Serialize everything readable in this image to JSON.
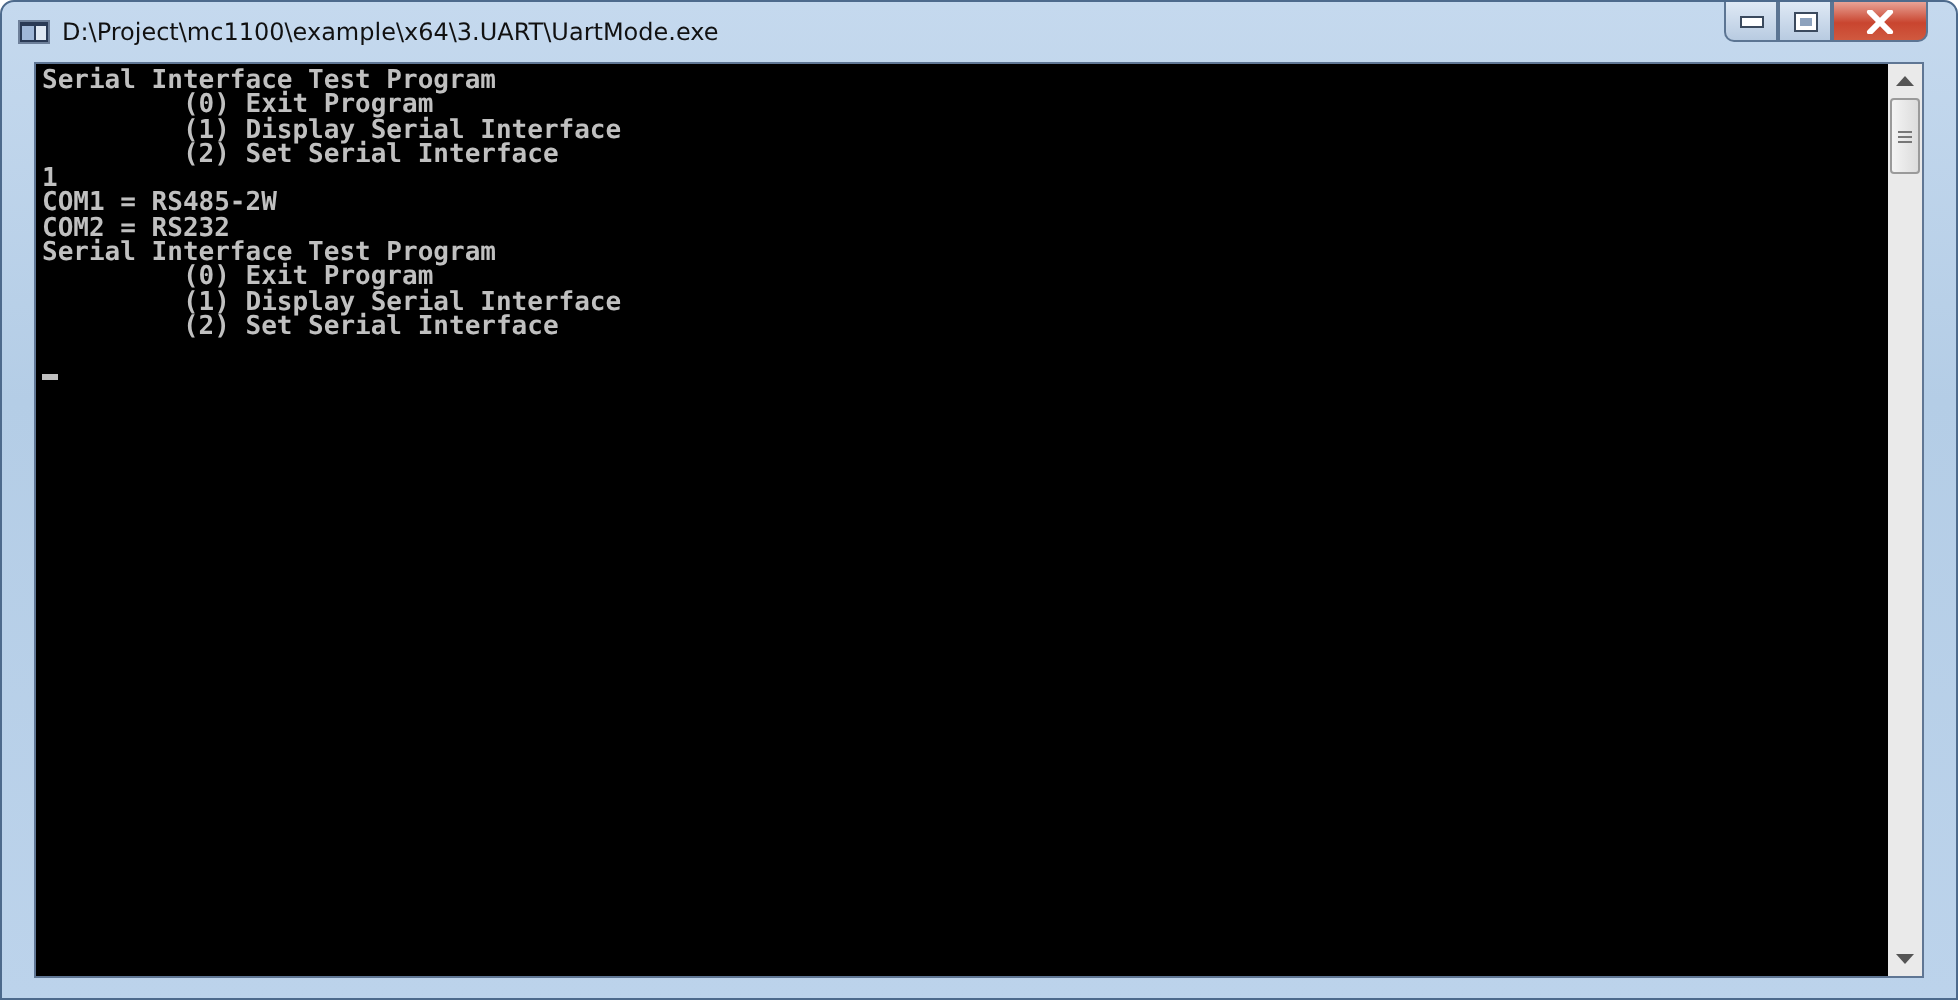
{
  "window": {
    "title": "D:\\Project\\mc1100\\example\\x64\\3.UART\\UartMode.exe"
  },
  "console": {
    "lines": [
      {
        "kind": "text",
        "text": "Serial Interface Test Program"
      },
      {
        "kind": "menu",
        "text": "(0) Exit Program"
      },
      {
        "kind": "menu",
        "text": "(1) Display Serial Interface"
      },
      {
        "kind": "menu",
        "text": "(2) Set Serial Interface"
      },
      {
        "kind": "text",
        "text": "1"
      },
      {
        "kind": "text",
        "text": "COM1 = RS485-2W"
      },
      {
        "kind": "text",
        "text": "COM2 = RS232"
      },
      {
        "kind": "text",
        "text": "Serial Interface Test Program"
      },
      {
        "kind": "menu",
        "text": "(0) Exit Program"
      },
      {
        "kind": "menu",
        "text": "(1) Display Serial Interface"
      },
      {
        "kind": "menu",
        "text": "(2) Set Serial Interface"
      },
      {
        "kind": "blank"
      },
      {
        "kind": "cursor"
      }
    ]
  }
}
